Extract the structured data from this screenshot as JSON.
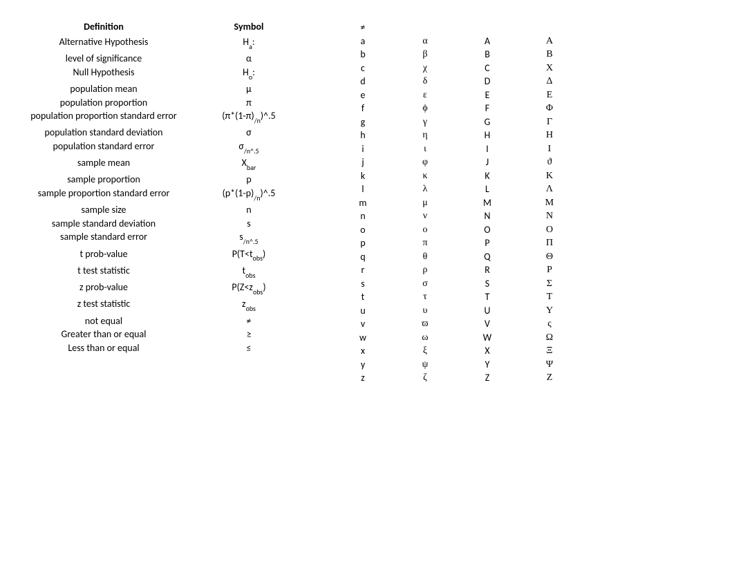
{
  "headers": {
    "def": "Definition",
    "sym": "Symbol"
  },
  "defs": [
    {
      "def": "Alternative Hypothesis",
      "sym": "H<sub class='sub'>a</sub>:"
    },
    {
      "def": "level of significance",
      "sym": "α"
    },
    {
      "def": "Null Hypothesis",
      "sym": "H<sub class='sub'>o</sub>:"
    },
    {
      "def": "population mean",
      "sym": "μ"
    },
    {
      "def": "population proportion",
      "sym": "π"
    },
    {
      "def": "population proportion standard error",
      "sym": "(π*(1-π)<sub class='sub'>/n</sub>)^.5"
    },
    {
      "def": "population standard deviation",
      "sym": "σ"
    },
    {
      "def": "population standard error",
      "sym": "σ<sub class='sub'>/n^.5</sub>"
    },
    {
      "def": "sample mean",
      "sym": "X<sub class='sub'>bar</sub>"
    },
    {
      "def": "sample proportion",
      "sym": "p"
    },
    {
      "def": "sample proportion standard error",
      "sym": "(p*(1-p)<sub class='sub'>/n</sub>)^.5"
    },
    {
      "def": "sample size",
      "sym": "n"
    },
    {
      "def": "sample standard deviation",
      "sym": "s"
    },
    {
      "def": "sample standard error",
      "sym": "s<sub class='sub'>/n^.5</sub>"
    },
    {
      "def": "t prob-value",
      "sym": "P(T&lt;t<sub class='sub'>obs</sub>)"
    },
    {
      "def": "t test statistic",
      "sym": "t<sub class='sub'>obs</sub>"
    },
    {
      "def": "z prob-value",
      "sym": "P(Z&lt;z<sub class='sub'>obs</sub>)"
    },
    {
      "def": "z test statistic",
      "sym": "z<sub class='sub'>obs</sub>"
    },
    {
      "def": "not equal",
      "sym": "≠"
    },
    {
      "def": "Greater than or equal",
      "sym": "≥"
    },
    {
      "def": "Less than or equal",
      "sym": "≤"
    }
  ],
  "greek_cols": [
    [
      "≠",
      "a",
      "b",
      "c",
      "d",
      "e",
      "f",
      "g",
      "h",
      "i",
      "j",
      "k",
      "l",
      "m",
      "n",
      "o",
      "p",
      "q",
      "r",
      "s",
      "t",
      "u",
      "v",
      "w",
      "x",
      "y",
      "z"
    ],
    [
      "",
      "α",
      "β",
      "χ",
      "δ",
      "ε",
      "ϕ",
      "γ",
      "η",
      "ι",
      "φ",
      "κ",
      "λ",
      "μ",
      "ν",
      "ο",
      "π",
      "θ",
      "ρ",
      "σ",
      "τ",
      "υ",
      "ϖ",
      "ω",
      "ξ",
      "ψ",
      "ζ"
    ],
    [
      "",
      "A",
      "B",
      "C",
      "D",
      "E",
      "F",
      "G",
      "H",
      "I",
      "J",
      "K",
      "L",
      "M",
      "N",
      "O",
      "P",
      "Q",
      "R",
      "S",
      "T",
      "U",
      "V",
      "W",
      "X",
      "Y",
      "Z"
    ],
    [
      "",
      "Α",
      "Β",
      "Χ",
      "Δ",
      "Ε",
      "Φ",
      "Γ",
      "Η",
      "Ι",
      "ϑ",
      "Κ",
      "Λ",
      "Μ",
      "Ν",
      "Ο",
      "Π",
      "Θ",
      "Ρ",
      "Σ",
      "Τ",
      "Υ",
      "ς",
      "Ω",
      "Ξ",
      "Ψ",
      "Ζ"
    ]
  ]
}
